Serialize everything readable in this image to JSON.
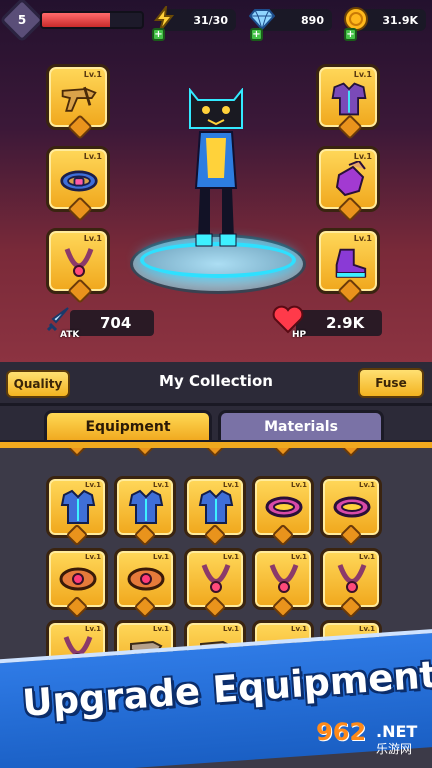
{
  "topbar": {
    "level": "5",
    "hp_fraction": 0.68,
    "energy": "31/30",
    "gems": "890",
    "coins": "31.9K"
  },
  "equipment_slots": {
    "left": [
      {
        "name": "crossbow",
        "level": "Lv.1"
      },
      {
        "name": "belt",
        "level": "Lv.1"
      },
      {
        "name": "necklace",
        "level": "Lv.1"
      }
    ],
    "right": [
      {
        "name": "armor",
        "level": "Lv.1"
      },
      {
        "name": "gloves",
        "level": "Lv.1"
      },
      {
        "name": "boots",
        "level": "Lv.1"
      }
    ]
  },
  "stats": {
    "atk_label": "ATK",
    "atk_value": "704",
    "hp_label": "HP",
    "hp_value": "2.9K"
  },
  "collection": {
    "quality_button": "Quality",
    "title": "My Collection",
    "fuse_button": "Fuse",
    "tabs": [
      "Equipment",
      "Materials"
    ],
    "active_tab": "Equipment"
  },
  "grid": {
    "rows": [
      [
        {
          "type": "armor",
          "level": "Lv.1"
        },
        {
          "type": "armor",
          "level": "Lv.1"
        },
        {
          "type": "armor",
          "level": "Lv.1"
        },
        {
          "type": "belt",
          "level": "Lv.1"
        },
        {
          "type": "belt",
          "level": "Lv.1"
        }
      ],
      [
        {
          "type": "ring",
          "level": "Lv.1"
        },
        {
          "type": "ring",
          "level": "Lv.1"
        },
        {
          "type": "necklace",
          "level": "Lv.1"
        },
        {
          "type": "necklace",
          "level": "Lv.1"
        },
        {
          "type": "necklace",
          "level": "Lv.1"
        }
      ],
      [
        {
          "type": "necklace",
          "level": "Lv.1"
        },
        {
          "type": "weapon",
          "level": "Lv.1"
        },
        {
          "type": "weapon",
          "level": "Lv.1"
        },
        {
          "type": "weapon",
          "level": "Lv.1"
        },
        {
          "type": "weapon",
          "level": "Lv.1"
        }
      ]
    ]
  },
  "banner": {
    "text": "Upgrade Equipment"
  },
  "watermark": {
    "number": "962",
    "domain": ".NET",
    "cn": "乐游网"
  },
  "colors": {
    "slot_gold": "#f6c234",
    "tab_inactive": "#7a72a6",
    "banner_blue": "#2f7be6",
    "ring_glow": "#2ee0ff"
  }
}
